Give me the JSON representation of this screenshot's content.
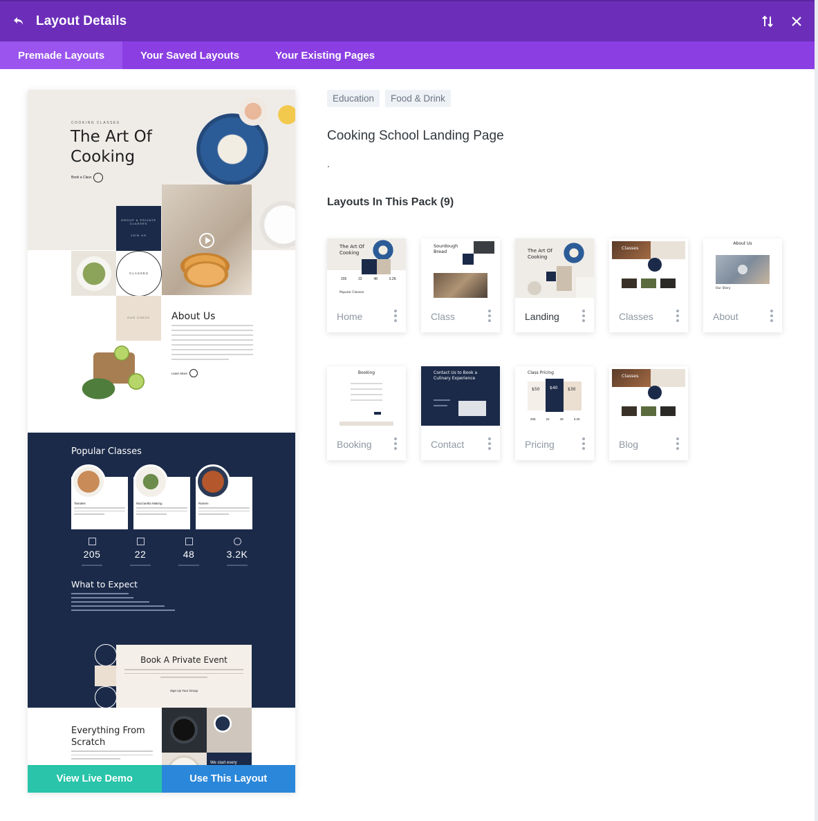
{
  "header": {
    "title": "Layout Details",
    "back_icon": "undo-arrow-icon",
    "sort_icon": "sort-arrows-icon",
    "close_icon": "close-icon",
    "bg_color": "#6c2eb9"
  },
  "tabs": [
    {
      "label": "Premade Layouts",
      "active": true
    },
    {
      "label": "Your Saved Layouts",
      "active": false
    },
    {
      "label": "Your Existing Pages",
      "active": false
    }
  ],
  "preview": {
    "kicker": "COOKING CLASSES",
    "hero_title": "The Art Of Cooking",
    "hero_button": "Book a Class",
    "group_box": "GROUP & PRIVATE CLASSES",
    "group_link": "JOIN US",
    "classes_circle": "CLASSES",
    "our_check": "OUR CHECK",
    "about_title": "About Us",
    "learn_more": "Learn More",
    "popular_title": "Popular Classes",
    "cards": [
      {
        "name": "Tamales"
      },
      {
        "name": "Mozzarella Making"
      },
      {
        "name": "Ramen"
      }
    ],
    "stats": [
      {
        "value": "205"
      },
      {
        "value": "22"
      },
      {
        "value": "48"
      },
      {
        "value": "3.2K"
      }
    ],
    "expect_title": "What to Expect",
    "event_title": "Book A Private Event",
    "signup": "Sign Up Your Group",
    "scratch_title": "Everything From Scratch",
    "we_start": "We start every"
  },
  "actions": {
    "demo_label": "View Live Demo",
    "use_label": "Use This Layout",
    "demo_color": "#29c4a9",
    "use_color": "#2b87da"
  },
  "detail": {
    "tags": [
      "Education",
      "Food & Drink"
    ],
    "title": "Cooking School Landing Page",
    "description": ".",
    "layouts_heading": "Layouts In This Pack (9)"
  },
  "layouts": [
    {
      "label": "Home",
      "active": false
    },
    {
      "label": "Class",
      "active": false
    },
    {
      "label": "Landing",
      "active": true
    },
    {
      "label": "Classes",
      "active": false
    },
    {
      "label": "About",
      "active": false
    },
    {
      "label": "Booking",
      "active": false
    },
    {
      "label": "Contact",
      "active": false
    },
    {
      "label": "Pricing",
      "active": false
    },
    {
      "label": "Blog",
      "active": false
    }
  ],
  "thumb_text": {
    "home_title": "The Art Of Cooking",
    "home_stats": [
      "205",
      "22",
      "48",
      "3.2K"
    ],
    "home_popular": "Popular Classes",
    "class_title": "Sourdough Bread",
    "landing_title": "The Art Of Cooking",
    "classes_title": "Classes",
    "about_title": "About Us",
    "about_story": "Our Story",
    "booking_title": "Booking",
    "contact_title": "Contact Us to Book a Culinary Experience",
    "pricing_title": "Class Pricing",
    "pricing_prices": [
      "$50",
      "$40",
      "$30"
    ],
    "pricing_stats": [
      "205",
      "22",
      "48",
      "3.2K"
    ],
    "blog_title": "Classes"
  }
}
